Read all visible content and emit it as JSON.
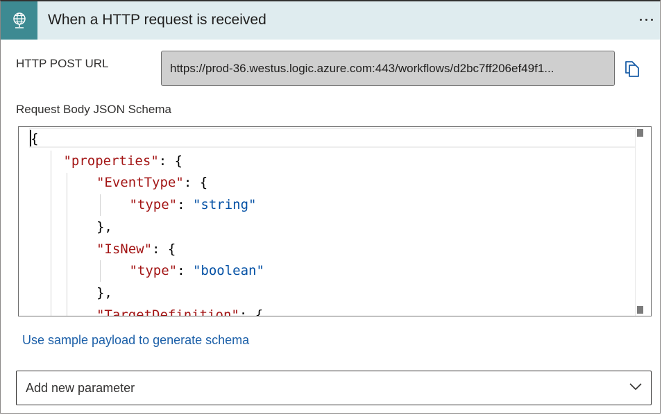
{
  "header": {
    "title": "When a HTTP request is received",
    "icon": "globe-icon",
    "accent_color": "#3d8a92",
    "background_color": "#dfecef"
  },
  "url": {
    "label": "HTTP POST URL",
    "value": "https://prod-36.westus.logic.azure.com:443/workflows/d2bc7ff206ef49f1..."
  },
  "schema": {
    "label": "Request Body JSON Schema",
    "lines": [
      {
        "tokens": [
          {
            "t": "p",
            "v": "{"
          }
        ]
      },
      {
        "tokens": [
          {
            "t": "k",
            "v": "\"properties\""
          },
          {
            "t": "p",
            "v": ": {"
          }
        ]
      },
      {
        "tokens": [
          {
            "t": "k",
            "v": "\"EventType\""
          },
          {
            "t": "p",
            "v": ": {"
          }
        ]
      },
      {
        "tokens": [
          {
            "t": "k",
            "v": "\"type\""
          },
          {
            "t": "p",
            "v": ": "
          },
          {
            "t": "s",
            "v": "\"string\""
          }
        ]
      },
      {
        "tokens": [
          {
            "t": "p",
            "v": "},"
          }
        ]
      },
      {
        "tokens": [
          {
            "t": "k",
            "v": "\"IsNew\""
          },
          {
            "t": "p",
            "v": ": {"
          }
        ]
      },
      {
        "tokens": [
          {
            "t": "k",
            "v": "\"type\""
          },
          {
            "t": "p",
            "v": ": "
          },
          {
            "t": "s",
            "v": "\"boolean\""
          }
        ]
      },
      {
        "tokens": [
          {
            "t": "p",
            "v": "},"
          }
        ]
      },
      {
        "tokens": [
          {
            "t": "k",
            "v": "\"TargetDefinition\""
          },
          {
            "t": "p",
            "v": ": {"
          }
        ]
      }
    ]
  },
  "sample_link": "Use sample payload to generate schema",
  "add_parameter": {
    "placeholder": "Add new parameter"
  }
}
